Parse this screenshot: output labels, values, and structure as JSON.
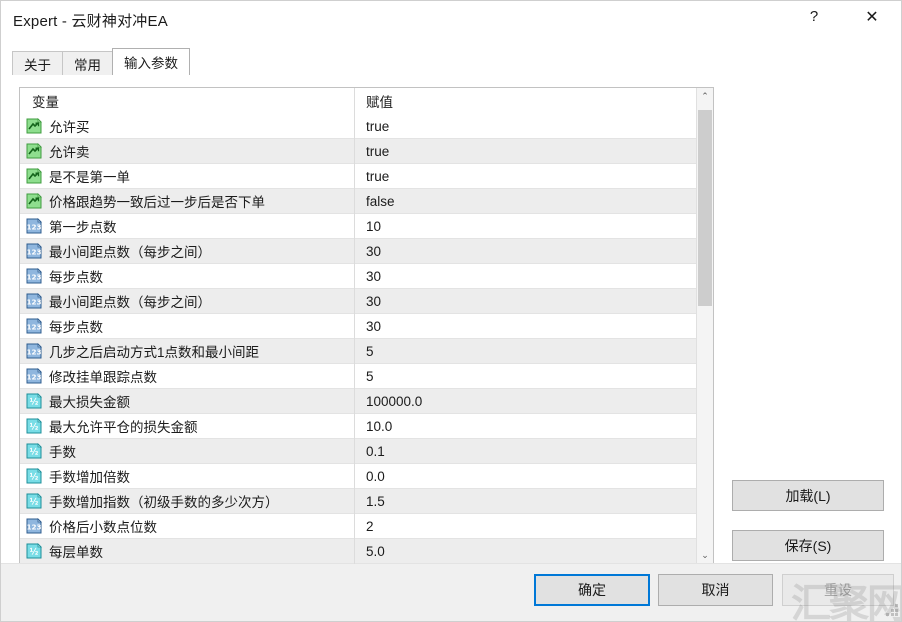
{
  "window": {
    "title": "Expert - 云财神对冲EA",
    "help_label": "?",
    "close_label": "✕"
  },
  "tabs": [
    {
      "label": "关于",
      "active": false
    },
    {
      "label": "常用",
      "active": false
    },
    {
      "label": "输入参数",
      "active": true
    }
  ],
  "table": {
    "headers": {
      "name": "变量",
      "value": "赋值"
    },
    "rows": [
      {
        "icon": "bool-type-icon",
        "name": "允许买",
        "value": "true"
      },
      {
        "icon": "bool-type-icon",
        "name": "允许卖",
        "value": "true"
      },
      {
        "icon": "bool-type-icon",
        "name": "是不是第一单",
        "value": "true"
      },
      {
        "icon": "bool-type-icon",
        "name": "价格跟趋势一致后过一步后是否下单",
        "value": "false"
      },
      {
        "icon": "int-type-icon",
        "name": "第一步点数",
        "value": "10"
      },
      {
        "icon": "int-type-icon",
        "name": "最小间距点数（每步之间）",
        "value": "30"
      },
      {
        "icon": "int-type-icon",
        "name": "每步点数",
        "value": "30"
      },
      {
        "icon": "int-type-icon",
        "name": "最小间距点数（每步之间）",
        "value": "30"
      },
      {
        "icon": "int-type-icon",
        "name": "每步点数",
        "value": "30"
      },
      {
        "icon": "int-type-icon",
        "name": "几步之后启动方式1点数和最小间距",
        "value": "5"
      },
      {
        "icon": "int-type-icon",
        "name": "修改挂单跟踪点数",
        "value": "5"
      },
      {
        "icon": "double-type-icon",
        "name": "最大损失金额",
        "value": "100000.0"
      },
      {
        "icon": "double-type-icon",
        "name": "最大允许平仓的损失金额",
        "value": "10.0"
      },
      {
        "icon": "double-type-icon",
        "name": "手数",
        "value": "0.1"
      },
      {
        "icon": "double-type-icon",
        "name": "手数增加倍数",
        "value": "0.0"
      },
      {
        "icon": "double-type-icon",
        "name": "手数增加指数（初级手数的多少次方）",
        "value": "1.5"
      },
      {
        "icon": "int-type-icon",
        "name": "价格后小数点位数",
        "value": "2"
      },
      {
        "icon": "double-type-icon",
        "name": "每层单数",
        "value": "5.0"
      }
    ]
  },
  "scrollbar": {
    "up_label": "⌃",
    "down_label": "⌄"
  },
  "side_buttons": {
    "load_label": "加载(L)",
    "save_label": "保存(S)"
  },
  "footer_buttons": {
    "ok_label": "确定",
    "cancel_label": "取消",
    "reset_label": "重设"
  },
  "watermark": {
    "text": "汇聚网"
  },
  "colors": {
    "accent": "#0078d7",
    "bool_icon": "#7bd47b",
    "int_icon": "#7ba7d9",
    "double_icon": "#6fd8e0",
    "row_alt": "#ededed",
    "button_face": "#e1e1e1"
  }
}
